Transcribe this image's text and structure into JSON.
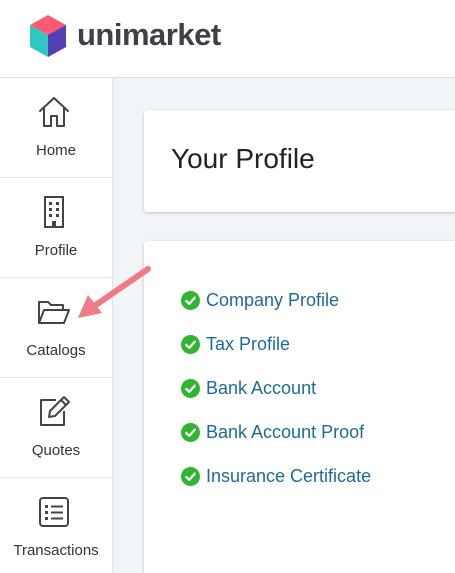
{
  "brand": {
    "name": "unimarket"
  },
  "sidebar": {
    "items": [
      {
        "label": "Home",
        "icon": "home-icon"
      },
      {
        "label": "Profile",
        "icon": "building-icon"
      },
      {
        "label": "Catalogs",
        "icon": "folder-open-icon"
      },
      {
        "label": "Quotes",
        "icon": "edit-icon"
      },
      {
        "label": "Transactions",
        "icon": "list-icon"
      }
    ]
  },
  "main": {
    "title": "Your Profile",
    "profile_items": [
      {
        "label": "Company Profile",
        "status": "complete"
      },
      {
        "label": "Tax Profile",
        "status": "complete"
      },
      {
        "label": "Bank Account",
        "status": "complete"
      },
      {
        "label": "Bank Account Proof",
        "status": "complete"
      },
      {
        "label": "Insurance Certificate",
        "status": "complete"
      }
    ]
  },
  "colors": {
    "link": "#1e6b9a",
    "check": "#2fb52f",
    "arrow": "#f07a85",
    "background": "#f2f5f8"
  }
}
